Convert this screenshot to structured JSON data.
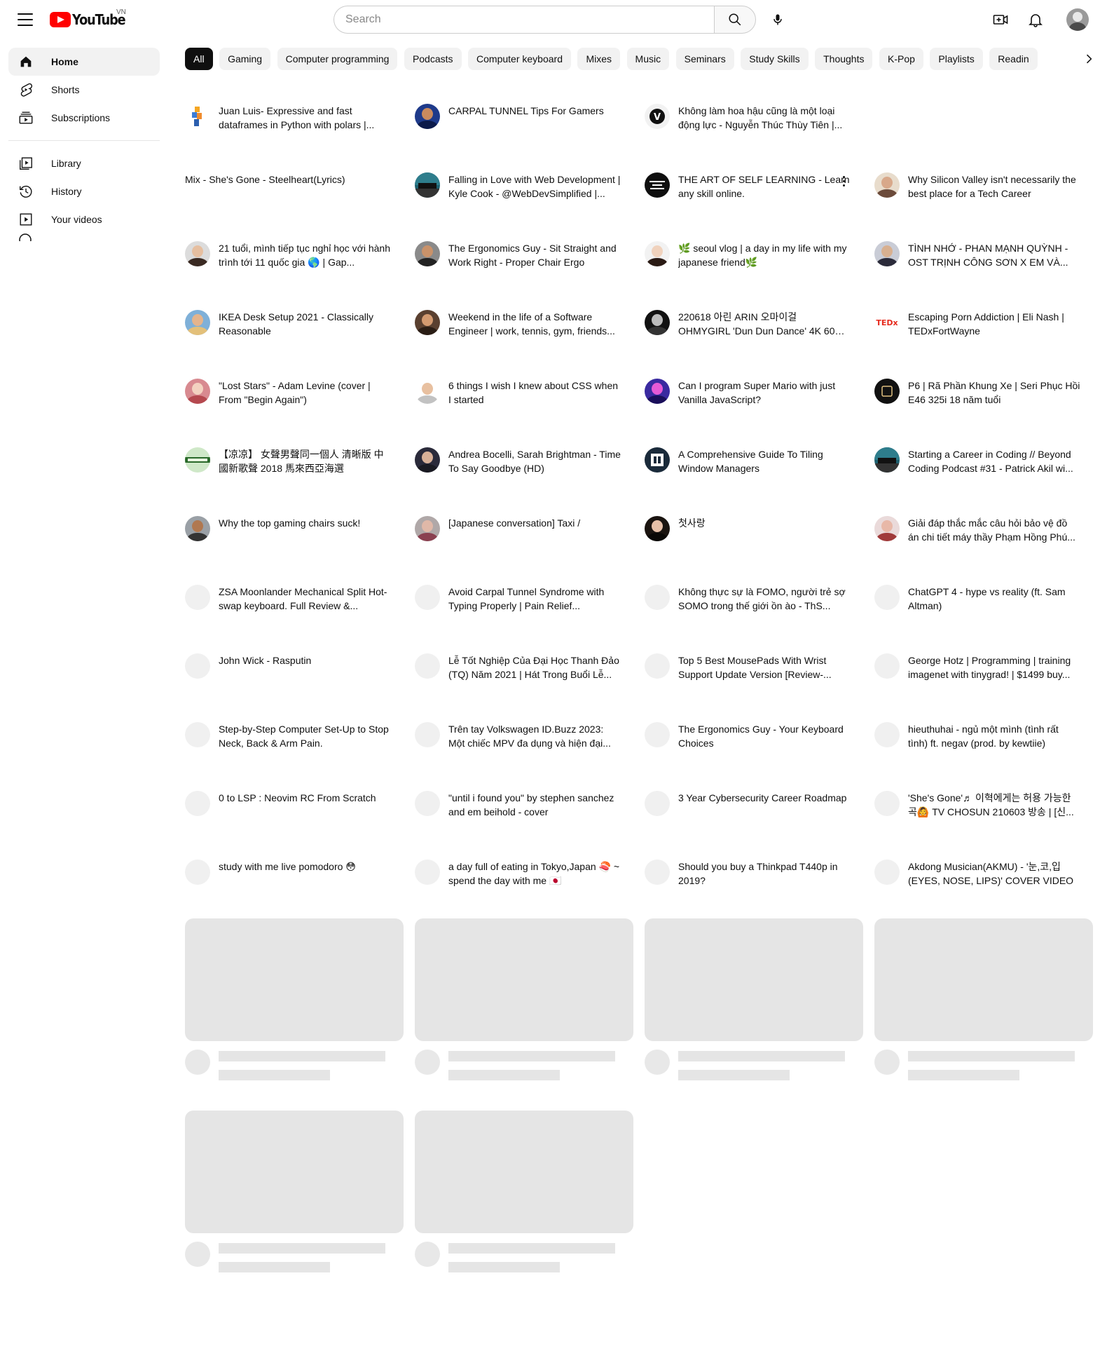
{
  "header": {
    "logo_text": "YouTube",
    "country_code": "VN",
    "search_placeholder": "Search"
  },
  "sidebar": {
    "items": [
      {
        "label": "Home",
        "icon": "home-icon",
        "active": true
      },
      {
        "label": "Shorts",
        "icon": "shorts-icon"
      },
      {
        "label": "Subscriptions",
        "icon": "subscriptions-icon"
      }
    ],
    "library_items": [
      {
        "label": "Library",
        "icon": "library-icon"
      },
      {
        "label": "History",
        "icon": "history-icon"
      },
      {
        "label": "Your videos",
        "icon": "your-videos-icon"
      }
    ]
  },
  "chips": [
    "All",
    "Gaming",
    "Computer programming",
    "Podcasts",
    "Computer keyboard",
    "Mixes",
    "Music",
    "Seminars",
    "Study Skills",
    "Thoughts",
    "K-Pop",
    "Playlists",
    "Readin"
  ],
  "videos": [
    {
      "title": "Juan Luis- Expressive and fast dataframes in Python with polars |...",
      "avatar": "polars"
    },
    {
      "title": "CARPAL TUNNEL Tips For Gamers",
      "avatar": "face-blue"
    },
    {
      "title": "Không làm hoa hậu cũng là một loại động lực - Nguyễn Thúc Thùy Tiên |...",
      "avatar": "v-logo"
    },
    {
      "title": "",
      "avatar": "none"
    },
    {
      "title": "Mix - She's Gone - Steelheart(Lyrics)",
      "avatar": "none"
    },
    {
      "title": "Falling in Love with Web Development | Kyle Cook - @WebDevSimplified |...",
      "avatar": "beyond-coding"
    },
    {
      "title": "THE ART OF SELF LEARNING - Learn any skill online.",
      "avatar": "learning-sharing",
      "more": true
    },
    {
      "title": "Why Silicon Valley isn't necessarily the best place for a Tech Career",
      "avatar": "face-woman"
    },
    {
      "title": "21 tuổi, mình tiếp tục nghỉ học với hành trình tới 11 quốc gia 🌎 | Gap...",
      "avatar": "face-woman2"
    },
    {
      "title": "The Ergonomics Guy - Sit Straight and Work Right - Proper Chair Ergo",
      "avatar": "face-man"
    },
    {
      "title": "🌿 seoul vlog | a day in my life with my japanese friend🌿",
      "avatar": "face-woman3"
    },
    {
      "title": "TÌNH NHỚ - PHAN MẠNH QUỲNH - OST TRỊNH CÔNG SƠN X EM VÀ...",
      "avatar": "face-man2"
    },
    {
      "title": "IKEA Desk Setup 2021 - Classically Reasonable",
      "avatar": "face-bald"
    },
    {
      "title": "Weekend in the life of a Software Engineer | work, tennis, gym, friends...",
      "avatar": "face-woman4"
    },
    {
      "title": "220618 아린 ARIN 오마이걸 OHMYGIRL 'Dun Dun Dance' 4K 60P ...",
      "avatar": "face-dark"
    },
    {
      "title": "Escaping Porn Addiction | Eli Nash | TEDxFortWayne",
      "avatar": "tedx"
    },
    {
      "title": "\"Lost Stars\" - Adam Levine (cover | From \"Begin Again\")",
      "avatar": "face-woman5"
    },
    {
      "title": "6 things I wish I knew about CSS when I started",
      "avatar": "face-man3"
    },
    {
      "title": "Can I program Super Mario with just Vanilla JavaScript?",
      "avatar": "face-neon"
    },
    {
      "title": "P6 | Rã Phần Khung Xe | Seri Phục Hồi E46 325i 18 năm tuổi",
      "avatar": "car-logo"
    },
    {
      "title": "【凉凉】 女聲男聲同一個人 清晰版 中國新歌聲 2018 馬來西亞海選",
      "avatar": "green-logo"
    },
    {
      "title": "Andrea Bocelli, Sarah Brightman - Time To Say Goodbye (HD)",
      "avatar": "face-old"
    },
    {
      "title": "A Comprehensive Guide To Tiling Window Managers",
      "avatar": "dt-logo"
    },
    {
      "title": "Starting a Career in Coding // Beyond Coding Podcast #31 - Patrick Akil wi...",
      "avatar": "beyond-coding"
    },
    {
      "title": "Why the top gaming chairs suck!",
      "avatar": "face-man4"
    },
    {
      "title": "[Japanese conversation] Taxi / ",
      "avatar": "face-group"
    },
    {
      "title": "첫사랑",
      "avatar": "face-woman6"
    },
    {
      "title": "Giải đáp thắc mắc câu hỏi bảo vệ đồ án chi tiết máy thầy Phạm Hồng Phú...",
      "avatar": "face-pink"
    },
    {
      "title": "ZSA Moonlander Mechanical Split Hot-swap keyboard. Full Review &...",
      "avatar": "blank"
    },
    {
      "title": "Avoid Carpal Tunnel Syndrome with Typing Properly | Pain Relief...",
      "avatar": "blank"
    },
    {
      "title": "Không thực sự là FOMO, người trẻ sợ SOMO trong thế giới ồn ào - ThS...",
      "avatar": "blank"
    },
    {
      "title": "ChatGPT 4 - hype vs reality (ft. Sam Altman)",
      "avatar": "blank"
    },
    {
      "title": "John Wick - Rasputin",
      "avatar": "blank"
    },
    {
      "title": "Lễ Tốt Nghiệp Của Đại Học Thanh Đảo (TQ) Năm 2021 | Hát Trong Buổi Lễ...",
      "avatar": "blank"
    },
    {
      "title": "Top 5 Best MousePads With Wrist Support Update Version [Review-...",
      "avatar": "blank"
    },
    {
      "title": "George Hotz | Programming | training imagenet with tinygrad! | $1499 buy...",
      "avatar": "blank"
    },
    {
      "title": "Step-by-Step Computer Set-Up to Stop Neck, Back & Arm Pain.",
      "avatar": "blank"
    },
    {
      "title": "Trên tay Volkswagen ID.Buzz 2023: Một chiếc MPV đa dụng và hiện đại...",
      "avatar": "blank"
    },
    {
      "title": "The Ergonomics Guy - Your Keyboard Choices",
      "avatar": "blank"
    },
    {
      "title": "hieuthuhai - ngủ một mình (tình rất tình) ft. negav (prod. by kewtiie)",
      "avatar": "blank"
    },
    {
      "title": "0 to LSP : Neovim RC From Scratch",
      "avatar": "blank"
    },
    {
      "title": "\"until i found you\" by stephen sanchez and em beihold - cover",
      "avatar": "blank"
    },
    {
      "title": "3 Year Cybersecurity Career Roadmap",
      "avatar": "blank"
    },
    {
      "title": "'She's Gone'♬ 이혁에게는 허용 가능한 곡🙆 TV CHOSUN 210603 방송 | [신...",
      "avatar": "blank"
    },
    {
      "title": "study with me live pomodoro 😳",
      "avatar": "blank"
    },
    {
      "title": "a day full of eating in Tokyo,Japan 🍣 ~ spend the day with me 🇯🇵",
      "avatar": "blank"
    },
    {
      "title": "Should you buy a Thinkpad T440p in 2019?",
      "avatar": "blank"
    },
    {
      "title": "Akdong Musician(AKMU) - '눈,코,입 (EYES, NOSE, LIPS)' COVER VIDEO",
      "avatar": "blank"
    }
  ],
  "skeleton_count": 6,
  "colors": {
    "brand_red": "#ff0000",
    "chip_bg": "#f2f2f2",
    "chip_selected": "#0f0f0f",
    "skeleton": "#e5e5e5"
  }
}
